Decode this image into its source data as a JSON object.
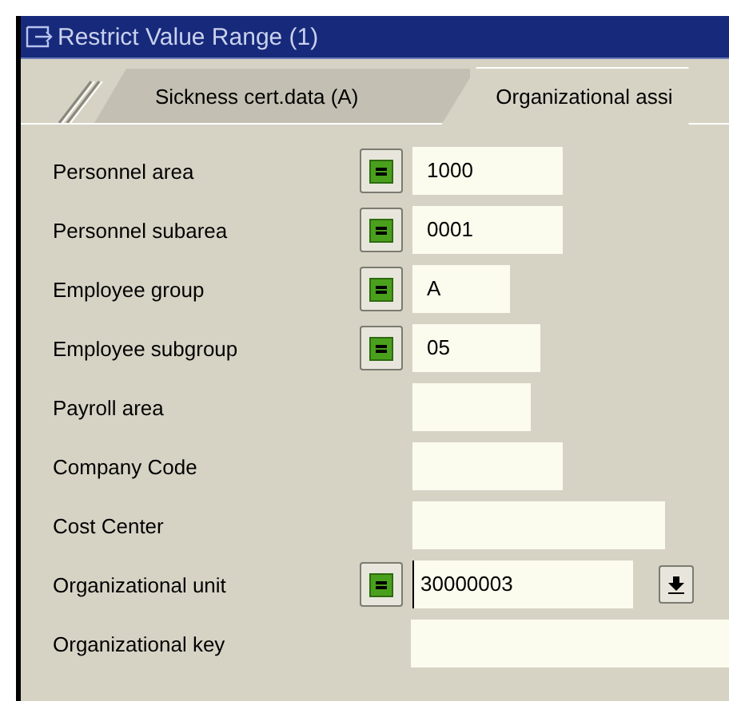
{
  "window": {
    "title": "Restrict Value Range (1)"
  },
  "tabs": [
    {
      "label": "Sickness cert.data (A)",
      "selected": false
    },
    {
      "label": "Organizational assi",
      "selected": true
    }
  ],
  "fields": [
    {
      "label": "Personnel area",
      "value": "1000",
      "option_button": true,
      "focused": false,
      "dropdown": false
    },
    {
      "label": "Personnel subarea",
      "value": "0001",
      "option_button": true,
      "focused": false,
      "dropdown": false
    },
    {
      "label": "Employee group",
      "value": "A",
      "option_button": true,
      "focused": false,
      "dropdown": false
    },
    {
      "label": "Employee subgroup",
      "value": "05",
      "option_button": true,
      "focused": false,
      "dropdown": false
    },
    {
      "label": "Payroll area",
      "option_button": false,
      "focused": false,
      "dropdown": false
    },
    {
      "label": "Company Code",
      "option_button": false,
      "focused": false,
      "dropdown": false
    },
    {
      "label": "Cost Center",
      "option_button": false,
      "focused": false,
      "dropdown": false
    },
    {
      "label": "Organizational unit",
      "value": "30000003",
      "option_button": true,
      "focused": true,
      "dropdown": true
    },
    {
      "label": "Organizational key",
      "option_button": false,
      "focused": false,
      "dropdown": false
    }
  ]
}
